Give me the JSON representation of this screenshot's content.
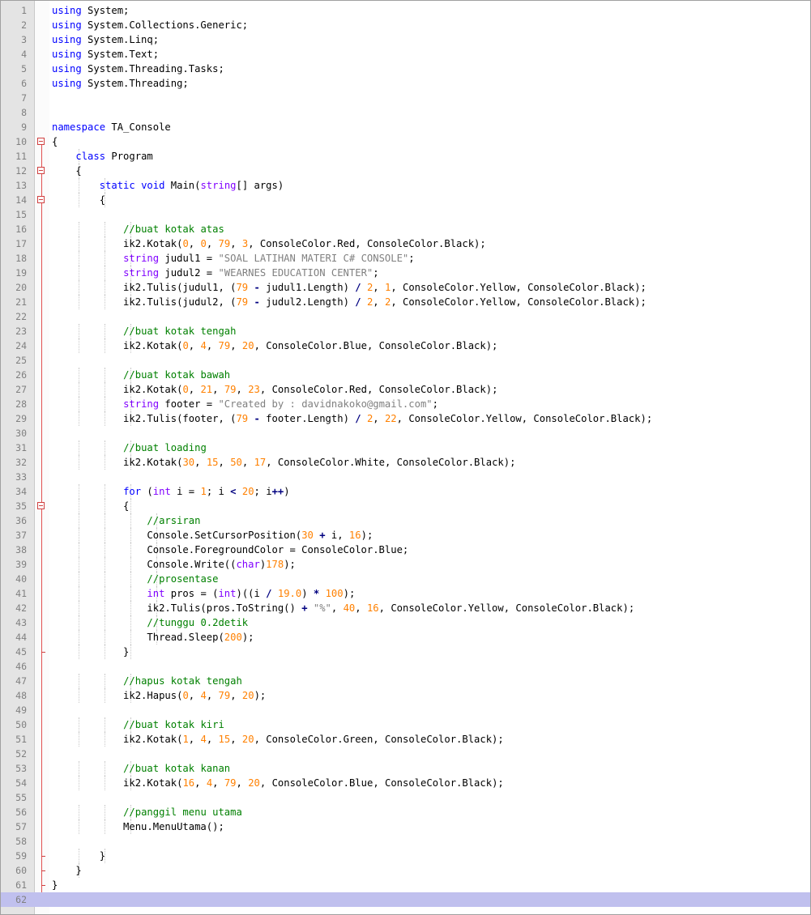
{
  "editor": {
    "language": "C#",
    "current_line": 62,
    "colors": {
      "keyword": "#0000ff",
      "type": "#8000ff",
      "number": "#ff8000",
      "string": "#808080",
      "comment": "#008000",
      "operator": "#000080",
      "current_line_bg": "#c0c0ee",
      "gutter_bg": "#e4e4e4",
      "fold_marker": "#d04040"
    },
    "lines": [
      "using System;",
      "using System.Collections.Generic;",
      "using System.Linq;",
      "using System.Text;",
      "using System.Threading.Tasks;",
      "using System.Threading;",
      "",
      "",
      "namespace TA_Console",
      "{",
      "    class Program",
      "    {",
      "        static void Main(string[] args)",
      "        {",
      "",
      "            //buat kotak atas",
      "            ik2.Kotak(0, 0, 79, 3, ConsoleColor.Red, ConsoleColor.Black);",
      "            string judul1 = \"SOAL LATIHAN MATERI C# CONSOLE\";",
      "            string judul2 = \"WEARNES EDUCATION CENTER\";",
      "            ik2.Tulis(judul1, (79 - judul1.Length) / 2, 1, ConsoleColor.Yellow, ConsoleColor.Black);",
      "            ik2.Tulis(judul2, (79 - judul2.Length) / 2, 2, ConsoleColor.Yellow, ConsoleColor.Black);",
      "",
      "            //buat kotak tengah",
      "            ik2.Kotak(0, 4, 79, 20, ConsoleColor.Blue, ConsoleColor.Black);",
      "",
      "            //buat kotak bawah",
      "            ik2.Kotak(0, 21, 79, 23, ConsoleColor.Red, ConsoleColor.Black);",
      "            string footer = \"Created by : davidnakoko@gmail.com\";",
      "            ik2.Tulis(footer, (79 - footer.Length) / 2, 22, ConsoleColor.Yellow, ConsoleColor.Black);",
      "",
      "            //buat loading",
      "            ik2.Kotak(30, 15, 50, 17, ConsoleColor.White, ConsoleColor.Black);",
      "",
      "            for (int i = 1; i < 20; i++)",
      "            {",
      "                //arsiran",
      "                Console.SetCursorPosition(30 + i, 16);",
      "                Console.ForegroundColor = ConsoleColor.Blue;",
      "                Console.Write((char)178);",
      "                //prosentase",
      "                int pros = (int)((i / 19.0) * 100);",
      "                ik2.Tulis(pros.ToString() + \"%\", 40, 16, ConsoleColor.Yellow, ConsoleColor.Black);",
      "                //tunggu 0.2detik",
      "                Thread.Sleep(200);",
      "            }",
      "",
      "            //hapus kotak tengah",
      "            ik2.Hapus(0, 4, 79, 20);",
      "",
      "            //buat kotak kiri",
      "            ik2.Kotak(1, 4, 15, 20, ConsoleColor.Green, ConsoleColor.Black);",
      "",
      "            //buat kotak kanan",
      "            ik2.Kotak(16, 4, 79, 20, ConsoleColor.Blue, ConsoleColor.Black);",
      "",
      "            //panggil menu utama",
      "            Menu.MenuUtama();",
      "",
      "        }",
      "    }",
      "}",
      ""
    ]
  }
}
